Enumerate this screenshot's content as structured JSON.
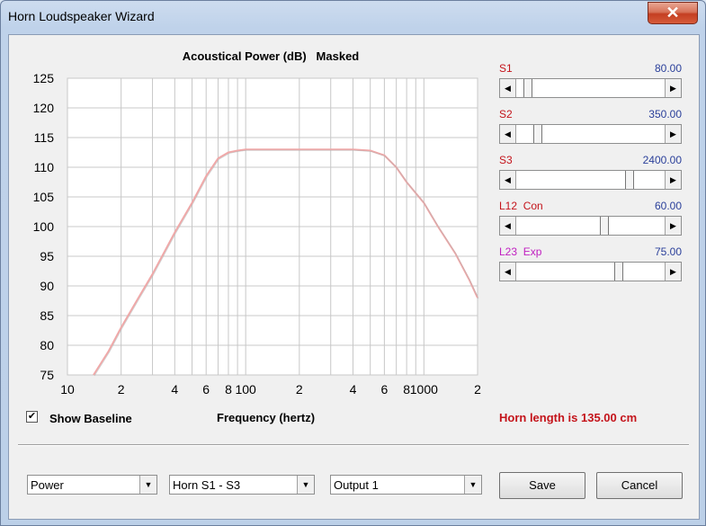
{
  "window": {
    "title": "Horn Loudspeaker Wizard",
    "close_glyph": "✕"
  },
  "chart_data": {
    "type": "line",
    "title": "Acoustical Power (dB)   Masked",
    "xlabel": "Frequency (hertz)",
    "ylabel": "",
    "x_scale": "log",
    "xlim": [
      10,
      2000
    ],
    "ylim": [
      75,
      125
    ],
    "yticks": [
      75,
      80,
      85,
      90,
      95,
      100,
      105,
      110,
      115,
      120,
      125
    ],
    "xtick_labels": [
      {
        "value": 10,
        "label": "10"
      },
      {
        "value": 20,
        "label": "2"
      },
      {
        "value": 40,
        "label": "4"
      },
      {
        "value": 60,
        "label": "6"
      },
      {
        "value": 80,
        "label": "8"
      },
      {
        "value": 100,
        "label": "100"
      },
      {
        "value": 200,
        "label": "2"
      },
      {
        "value": 400,
        "label": "4"
      },
      {
        "value": 600,
        "label": "6"
      },
      {
        "value": 800,
        "label": "8"
      },
      {
        "value": 1000,
        "label": "1000"
      },
      {
        "value": 2000,
        "label": "2"
      }
    ],
    "grid": true,
    "series": [
      {
        "color": "#f0a8a8",
        "x": [
          14,
          17,
          20,
          25,
          30,
          40,
          50,
          60,
          70,
          80,
          90,
          100,
          150,
          200,
          300,
          400,
          500,
          600,
          700,
          800,
          1000,
          1200,
          1500,
          1800,
          2000
        ],
        "y": [
          75,
          79,
          83,
          88,
          92,
          99,
          104,
          108.5,
          111.5,
          112.5,
          112.8,
          113,
          113,
          113,
          113,
          113,
          112.8,
          112,
          110,
          107.5,
          104,
          100,
          95.5,
          91,
          88
        ]
      }
    ]
  },
  "sliders": [
    {
      "label": "S1",
      "value": "80.00",
      "label_color": "#c4141b",
      "position": 0.06
    },
    {
      "label": "S2",
      "value": "350.00",
      "label_color": "#c4141b",
      "position": 0.13
    },
    {
      "label": "S3",
      "value": "2400.00",
      "label_color": "#c4141b",
      "position": 0.78
    },
    {
      "label": "L12  Con",
      "value": "60.00",
      "label_color": "#c4141b",
      "position": 0.6
    },
    {
      "label": "L23  Exp",
      "value": "75.00",
      "label_color": "#c020c0",
      "position": 0.7
    }
  ],
  "show_baseline": {
    "label": "Show Baseline",
    "checked_glyph": "✔"
  },
  "horn_length": "Horn length is 135.00 cm",
  "dropdowns": [
    {
      "value": "Power"
    },
    {
      "value": "Horn S1 - S3"
    },
    {
      "value": "Output 1"
    }
  ],
  "buttons": {
    "save": "Save",
    "cancel": "Cancel"
  },
  "icons": {
    "arrow_left": "◀",
    "arrow_right": "▶",
    "arrow_down": "▼"
  }
}
